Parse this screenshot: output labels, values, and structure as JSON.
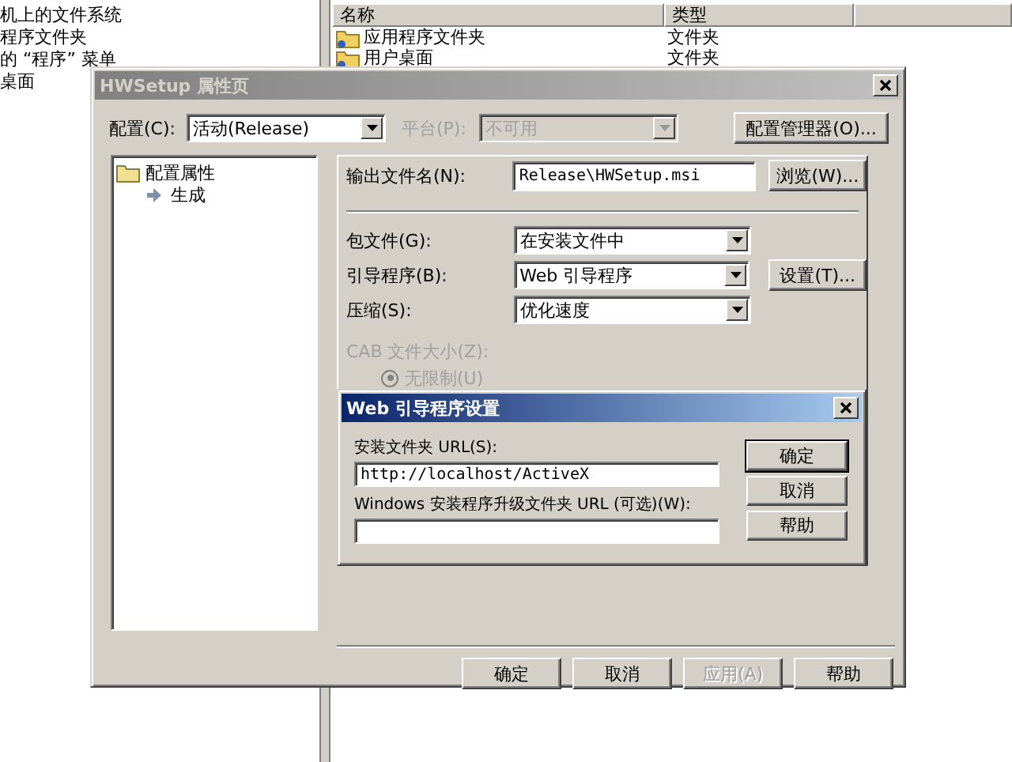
{
  "explorer": {
    "tree_items": [
      "机上的文件系统",
      "程序文件夹",
      "的 “程序” 菜单",
      "桌面"
    ],
    "list": {
      "columns": [
        "名称",
        "类型"
      ],
      "rows": [
        {
          "name": "应用程序文件夹",
          "type": "文件夹"
        },
        {
          "name": "用户桌面",
          "type": "文件夹"
        }
      ]
    }
  },
  "dialog": {
    "title": "HWSetup 属性页",
    "active": false,
    "config": {
      "label": "配置(C):",
      "value": "活动(Release)"
    },
    "platform": {
      "label": "平台(P):",
      "value": "不可用",
      "disabled": true
    },
    "config_manager_button": "配置管理器(O)...",
    "tree": {
      "label": "配置属性",
      "children": [
        {
          "label": "生成"
        }
      ]
    },
    "output_file": {
      "label": "输出文件名(N):",
      "value": "Release\\HWSetup.msi",
      "button": "浏览(W)..."
    },
    "settings": [
      {
        "label": "包文件(G):",
        "value": "在安装文件中"
      },
      {
        "label": "引导程序(B):",
        "value": "Web 引导程序",
        "button": "设置(T)..."
      },
      {
        "label": "压缩(S):",
        "value": "优化速度"
      }
    ],
    "cab": {
      "label": "CAB 文件大小(Z):",
      "disabled": true,
      "options": [
        {
          "label": "无限制(U)",
          "selected": true
        }
      ]
    },
    "buttons": [
      {
        "label": "确定",
        "disabled": false
      },
      {
        "label": "取消",
        "disabled": false
      },
      {
        "label": "应用(A)",
        "disabled": true
      },
      {
        "label": "帮助",
        "disabled": false
      }
    ]
  },
  "subdialog": {
    "title": "Web 引导程序设置",
    "active": true,
    "fields": [
      {
        "label": "安装文件夹 URL(S):",
        "value": "http://localhost/ActiveX"
      },
      {
        "label": "Windows 安装程序升级文件夹 URL (可选)(W):"
      }
    ],
    "buttons": [
      {
        "label": "确定",
        "default": true
      },
      {
        "label": "取消",
        "default": false
      },
      {
        "label": "帮助",
        "default": false
      }
    ]
  }
}
